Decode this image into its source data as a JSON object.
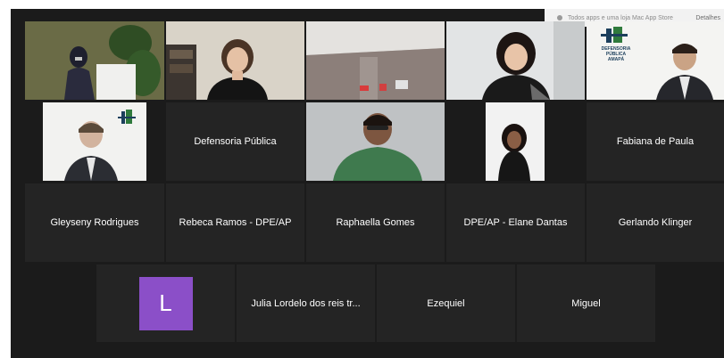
{
  "notification": {
    "text": "Todos apps e uma loja Mac App Store",
    "action": "Detalhes"
  },
  "rows": [
    [
      {
        "id": "p1",
        "type": "video",
        "label": "Speaker at lectern"
      },
      {
        "id": "p2",
        "type": "video",
        "label": "Woman"
      },
      {
        "id": "p3",
        "type": "video",
        "label": "Room"
      },
      {
        "id": "p4",
        "type": "video",
        "label": "Woman"
      },
      {
        "id": "p5",
        "type": "video",
        "label": "Man with logo"
      }
    ],
    [
      {
        "id": "p6",
        "type": "video",
        "label": "Man with logo"
      },
      {
        "id": "p7",
        "type": "name",
        "name": "Defensoria Pública"
      },
      {
        "id": "p8",
        "type": "video",
        "label": "Man in green"
      },
      {
        "id": "p9",
        "type": "video",
        "label": "Woman standing"
      },
      {
        "id": "p10",
        "type": "name",
        "name": "Fabiana de Paula"
      }
    ],
    [
      {
        "id": "p11",
        "type": "name",
        "name": "Gleyseny Rodrigues"
      },
      {
        "id": "p12",
        "type": "name",
        "name": "Rebeca Ramos - DPE/AP"
      },
      {
        "id": "p13",
        "type": "name",
        "name": "Raphaella Gomes"
      },
      {
        "id": "p14",
        "type": "name",
        "name": "DPE/AP - Elane Dantas"
      },
      {
        "id": "p15",
        "type": "name",
        "name": "Gerlando Klinger"
      }
    ],
    [
      {
        "id": "p16",
        "type": "avatar",
        "initial": "L"
      },
      {
        "id": "p17",
        "type": "name",
        "name": "Julia Lordelo dos reis tr..."
      },
      {
        "id": "p18",
        "type": "name",
        "name": "Ezequiel"
      },
      {
        "id": "p19",
        "type": "name",
        "name": "Miguel"
      }
    ]
  ],
  "logo_text": "DEFENSORIA PÚBLICA",
  "logo_sub": "AMAPÁ",
  "colors": {
    "background": "#1b1b1b",
    "tile": "#242424",
    "active_border": "#d9e26a",
    "avatar": "#8b4fc8"
  }
}
